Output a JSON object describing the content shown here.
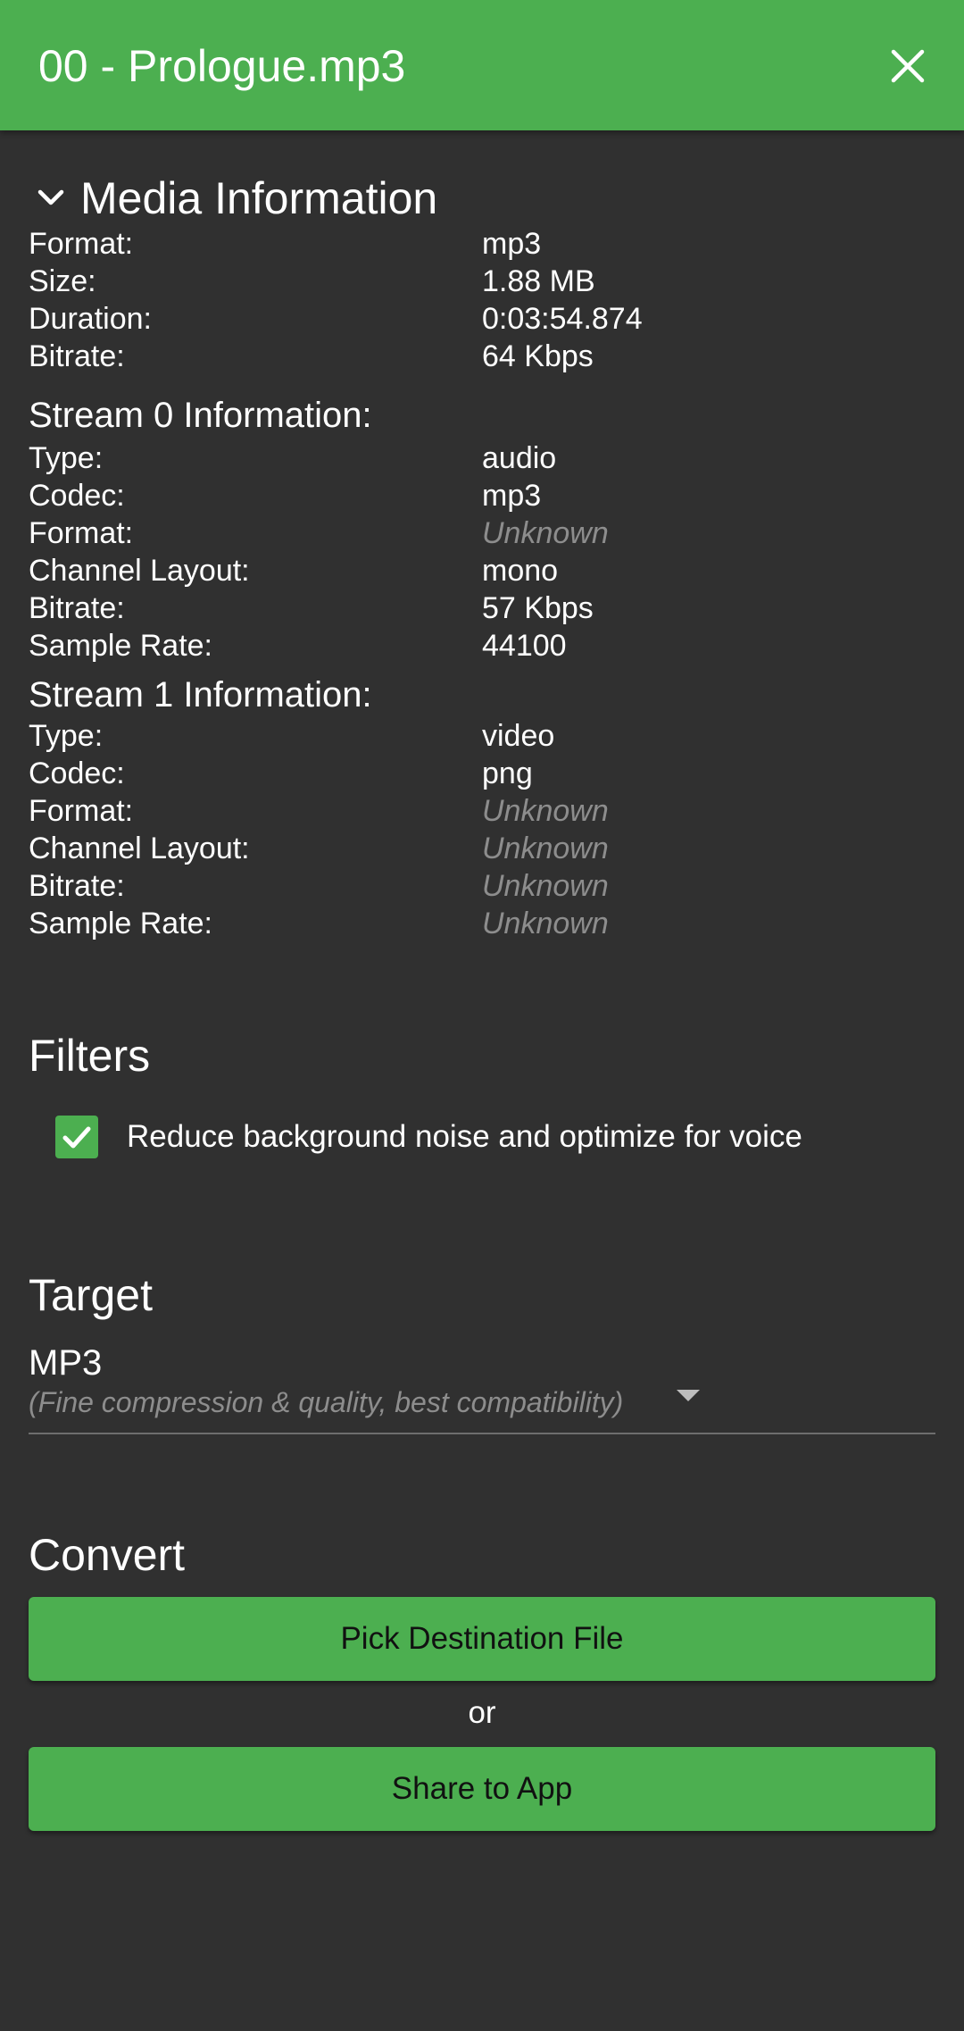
{
  "app_bar": {
    "title": "00 - Prologue.mp3",
    "close_icon": "close-icon"
  },
  "media": {
    "heading": "Media Information",
    "rows": [
      {
        "key": "Format:",
        "value": "mp3"
      },
      {
        "key": "Size:",
        "value": "1.88 MB"
      },
      {
        "key": "Duration:",
        "value": "0:03:54.874"
      },
      {
        "key": "Bitrate:",
        "value": "64 Kbps"
      }
    ]
  },
  "streams": [
    {
      "heading": "Stream 0 Information:",
      "rows": [
        {
          "key": "Type:",
          "value": "audio"
        },
        {
          "key": "Codec:",
          "value": "mp3"
        },
        {
          "key": "Format:",
          "value": "Unknown"
        },
        {
          "key": "Channel Layout:",
          "value": "mono"
        },
        {
          "key": "Bitrate:",
          "value": "57 Kbps"
        },
        {
          "key": "Sample Rate:",
          "value": "44100"
        }
      ]
    },
    {
      "heading": "Stream 1 Information:",
      "rows": [
        {
          "key": "Type:",
          "value": "video"
        },
        {
          "key": "Codec:",
          "value": "png"
        },
        {
          "key": "Format:",
          "value": "Unknown"
        },
        {
          "key": "Channel Layout:",
          "value": "Unknown"
        },
        {
          "key": "Bitrate:",
          "value": "Unknown"
        },
        {
          "key": "Sample Rate:",
          "value": "Unknown"
        }
      ]
    }
  ],
  "filters": {
    "heading": "Filters",
    "noise_filter": {
      "label": "Reduce background noise and optimize for voice",
      "checked": true
    }
  },
  "target": {
    "heading": "Target",
    "selected": "MP3",
    "description": "(Fine compression & quality, best compatibility)"
  },
  "convert": {
    "heading": "Convert",
    "pick_button": "Pick Destination File",
    "or_text": "or",
    "share_button": "Share to App"
  },
  "colors": {
    "accent": "#4caf50",
    "background": "#303030",
    "muted": "#8d8d8d"
  }
}
